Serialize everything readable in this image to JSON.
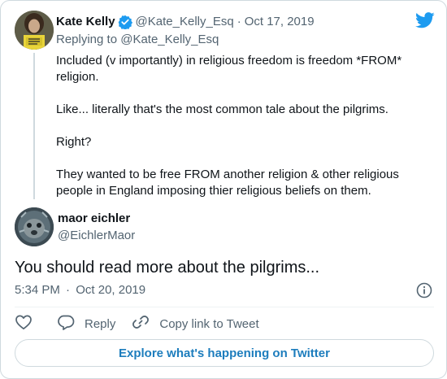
{
  "parent_tweet": {
    "author_name": "Kate Kelly",
    "author_handle": "@Kate_Kelly_Esq",
    "separator": "·",
    "date": "Oct 17, 2019",
    "replying_prefix": "Replying to",
    "replying_to": "@Kate_Kelly_Esq",
    "paragraphs": [
      "Included (v importantly) in religious freedom is freedom *FROM* religion.",
      "Like... literally that's the most common tale about the pilgrims.",
      "Right?",
      "They wanted to be free FROM another religion & other religious people in England imposing thier religious beliefs on them."
    ]
  },
  "main_tweet": {
    "author_name": "maor eichler",
    "author_handle": "@EichlerMaor",
    "text": "You should read more about the pilgrims...",
    "time": "5:34 PM",
    "separator": "·",
    "date": "Oct 20, 2019"
  },
  "actions": {
    "reply_label": "Reply",
    "copy_link_label": "Copy link to Tweet"
  },
  "explore_label": "Explore what's happening on Twitter",
  "icons": {
    "brand": "twitter-bird-icon",
    "verified": "verified-badge-icon",
    "info": "info-icon",
    "like": "heart-icon",
    "reply": "reply-bubble-icon",
    "link": "link-icon"
  },
  "colors": {
    "brand_blue": "#1d9bf0",
    "link_blue": "#1d7dbd",
    "text": "#0f1419",
    "muted": "#536471",
    "border": "#cfd9de"
  }
}
